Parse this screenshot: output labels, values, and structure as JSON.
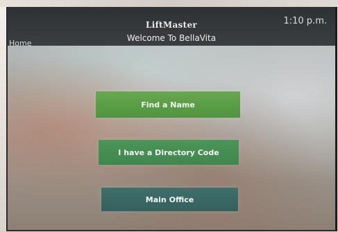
{
  "header": {
    "brand": "LiftMaster",
    "welcome": "Welcome To BellaVita",
    "time": "1:10 p.m.",
    "home_label": "Home"
  },
  "menu": {
    "buttons": [
      {
        "label": "Find a Name"
      },
      {
        "label": "I have a Directory Code"
      },
      {
        "label": "Main Office"
      }
    ]
  },
  "colors": {
    "header_bar": "#33363a",
    "find_button": "#5b9f48",
    "directory_button": "#45904f",
    "office_button": "#386764"
  }
}
